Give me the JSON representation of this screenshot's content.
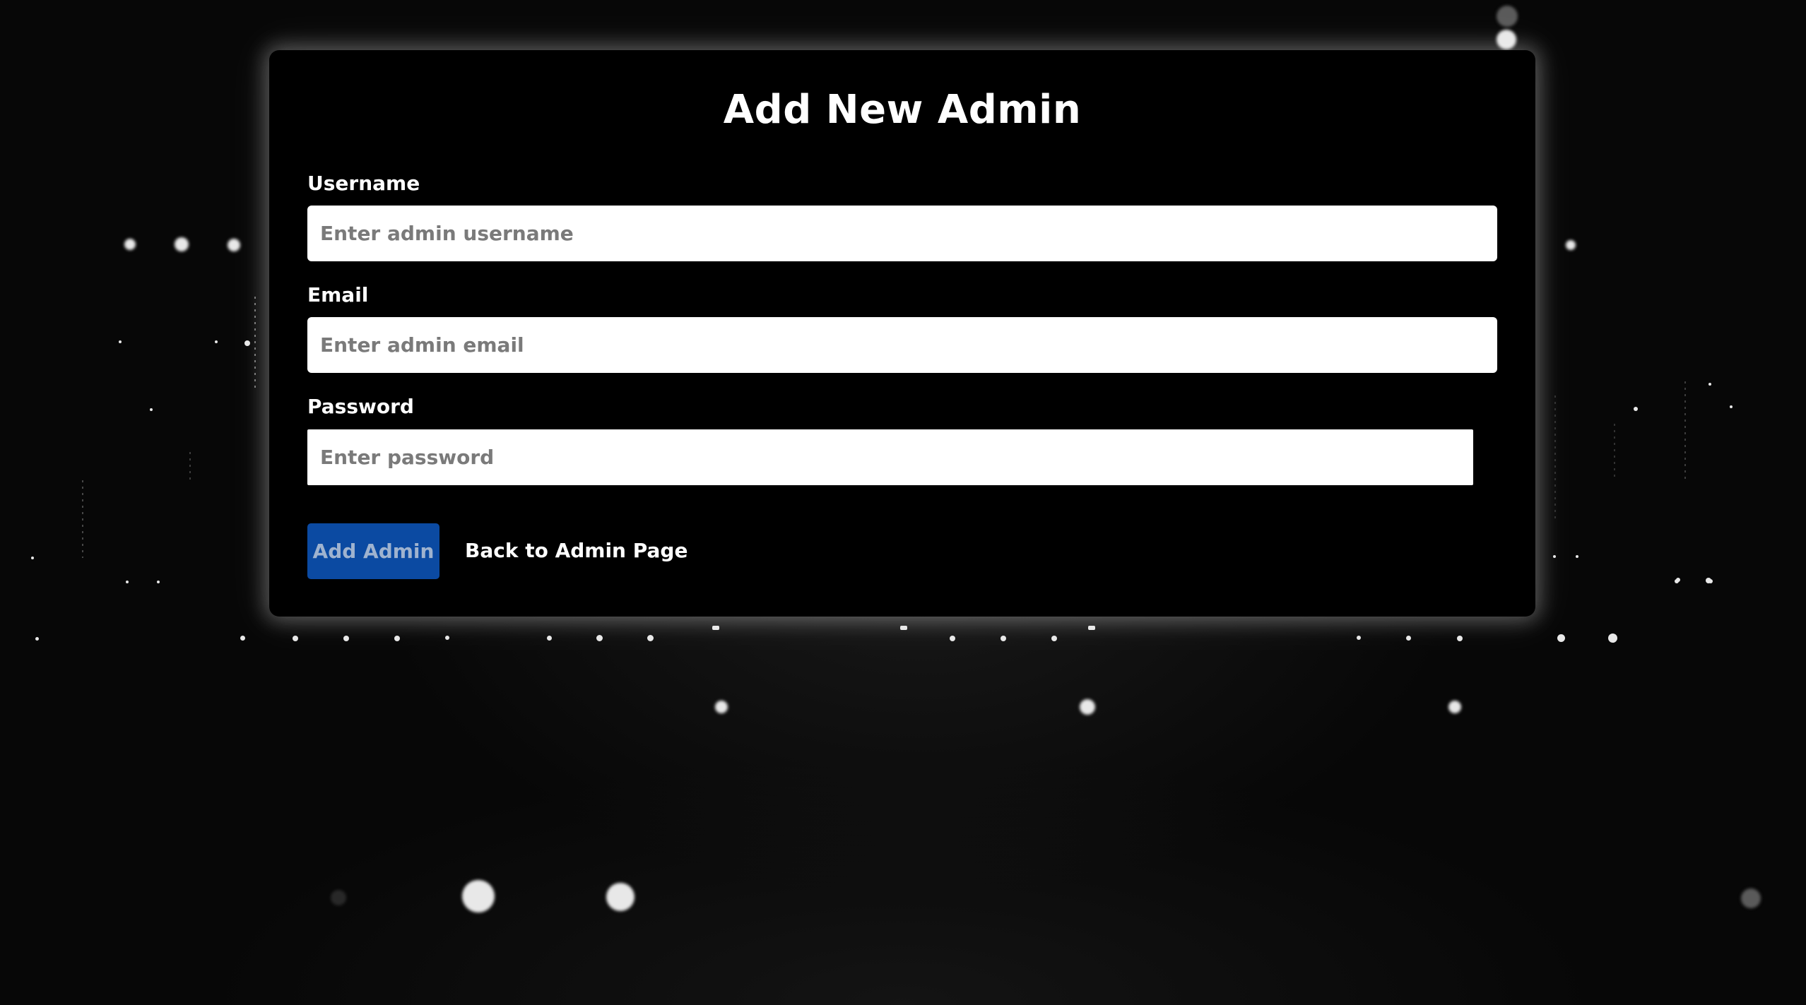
{
  "form": {
    "title": "Add New Admin",
    "username": {
      "label": "Username",
      "placeholder": "Enter admin username",
      "value": ""
    },
    "email": {
      "label": "Email",
      "placeholder": "Enter admin email",
      "value": ""
    },
    "password": {
      "label": "Password",
      "placeholder": "Enter password",
      "value": ""
    },
    "submit_label": "Add Admin",
    "back_label": "Back to Admin Page"
  },
  "colors": {
    "page_background": "#070707",
    "card_background": "#000000",
    "primary_button": "#0b4aa2",
    "primary_button_text": "#9fb3cf",
    "text": "#ffffff"
  }
}
